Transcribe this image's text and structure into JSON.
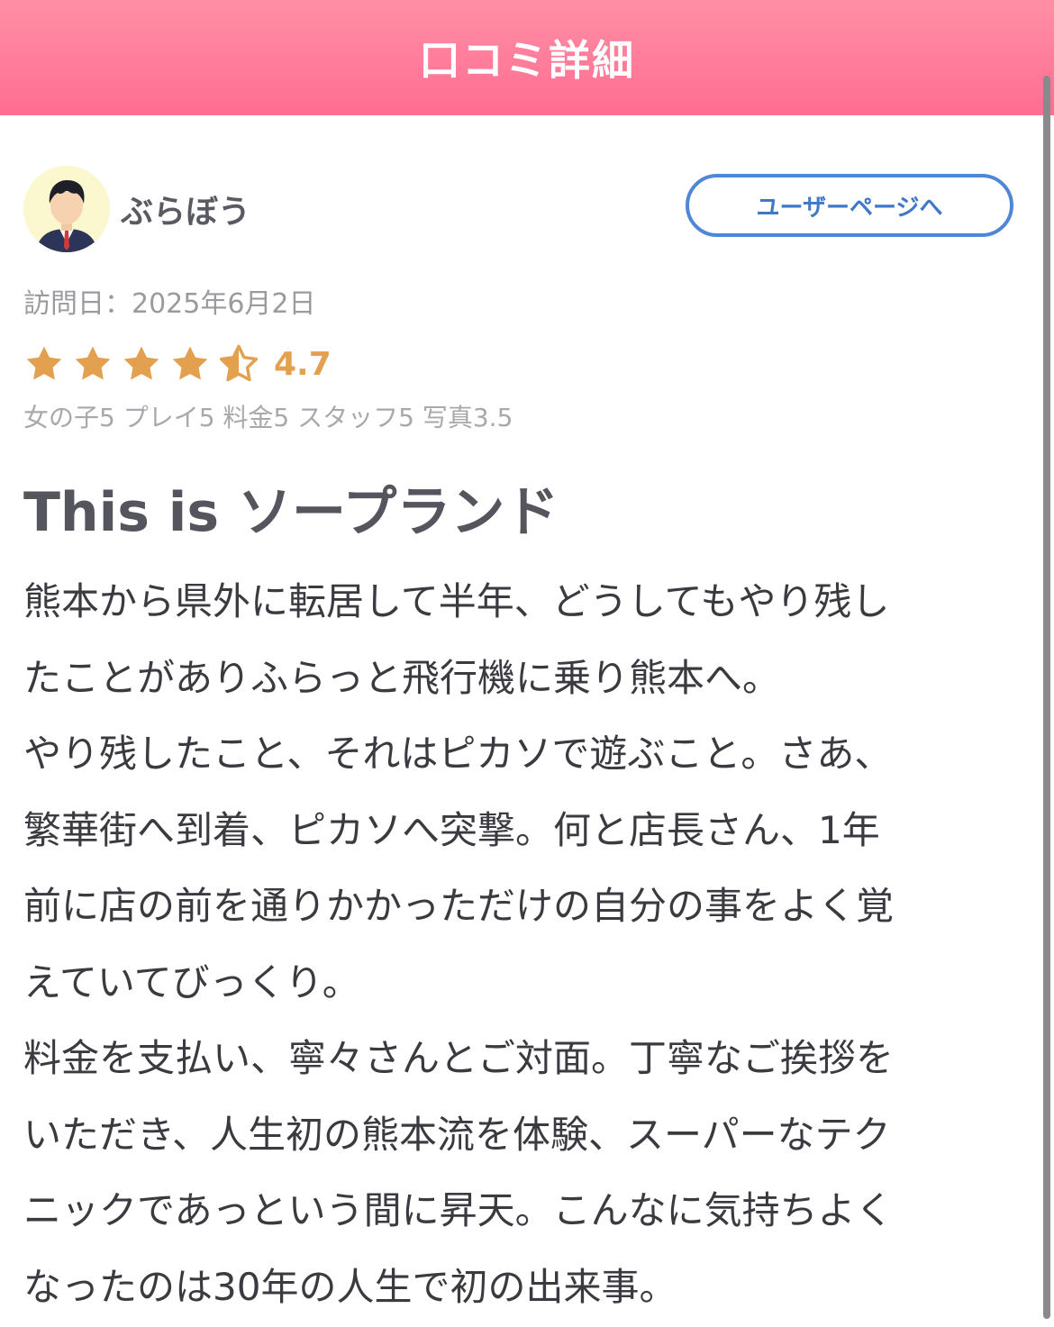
{
  "header": {
    "title": "口コミ詳細"
  },
  "user": {
    "name": "ぶらぼう",
    "user_page_button": "ユーザーページへ",
    "avatar": "user-avatar"
  },
  "visit": {
    "text": "訪問日：2025年6月2日"
  },
  "rating": {
    "stars": 4.5,
    "value": "4.7",
    "star_color": "#e3a04e",
    "sub_scores": "女の子5 プレイ5 料金5 スタッフ5 写真3.5"
  },
  "review": {
    "title": "This is ソープランド",
    "lines": [
      "熊本から県外に転居して半年、どうしてもやり残し",
      "たことがありふらっと飛行機に乗り熊本へ。",
      "やり残したこと、それはピカソで遊ぶこと。さあ、",
      "繁華街へ到着、ピカソへ突撃。何と店長さん、1年",
      "前に店の前を通りかかっただけの自分の事をよく覚",
      "えていてびっくり。",
      "料金を支払い、寧々さんとご対面。丁寧なご挨拶を",
      "いただき、人生初の熊本流を体験、スーパーなテク",
      "ニックであっという間に昇天。こんなに気持ちよく",
      "なったのは30年の人生で初の出来事。"
    ]
  },
  "colors": {
    "header_top": "#ff8fa5",
    "header_bottom": "#ff6d91",
    "button_border": "#4f86d6"
  }
}
